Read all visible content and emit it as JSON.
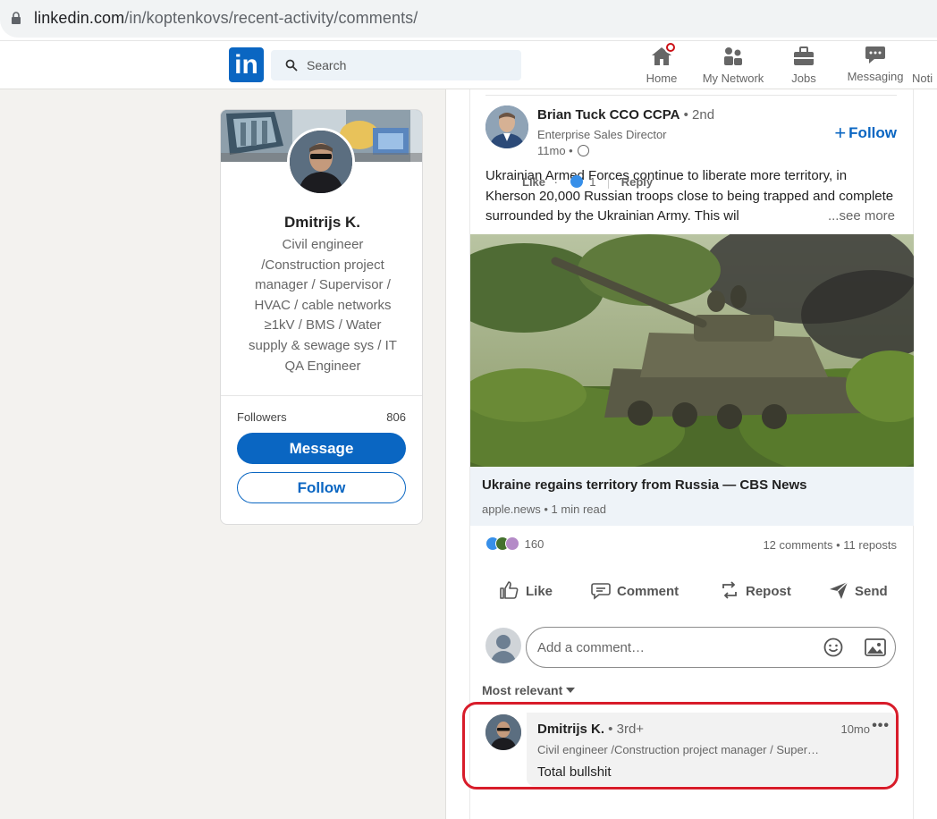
{
  "browser": {
    "url_host": "linkedin.com",
    "url_path": "/in/koptenkovs/recent-activity/comments/"
  },
  "nav": {
    "logo": "in",
    "search_placeholder": "Search",
    "items": [
      {
        "label": "Home",
        "icon": "home-icon"
      },
      {
        "label": "My Network",
        "icon": "network-icon"
      },
      {
        "label": "Jobs",
        "icon": "briefcase-icon"
      },
      {
        "label": "Messaging",
        "icon": "chat-icon"
      },
      {
        "label": "Noti",
        "icon": "bell-icon"
      }
    ]
  },
  "profile": {
    "name": "Dmitrijs K.",
    "headline": "Civil engineer /Construction project manager / Supervisor / HVAC / cable networks ≥1kV / BMS / Water supply & sewage sys / IT QA Engineer",
    "followers_label": "Followers",
    "followers_count": "806",
    "message_label": "Message",
    "follow_label": "Follow"
  },
  "post": {
    "author_name": "Brian Tuck CCO CCPA",
    "author_degree": " • 2nd",
    "author_title": "Enterprise Sales Director",
    "time": "11mo • ",
    "follow_label": "Follow",
    "text": "Ukrainian Armed Forces continue to liberate more territory, in Kherson 20,000 Russian troops close to being trapped and complete surrounded by the Ukrainian Army. This wil",
    "see_more": "...see more",
    "link_title": "Ukraine regains territory from Russia — CBS News",
    "link_source": "apple.news • 1 min read",
    "reaction_count": "160",
    "stats": "12 comments • 11 reposts",
    "actions": {
      "like": "Like",
      "comment": "Comment",
      "repost": "Repost",
      "send": "Send"
    },
    "comment_placeholder": "Add a comment…",
    "sort_label": "Most relevant"
  },
  "comment": {
    "name": "Dmitrijs K.",
    "degree": " • 3rd+",
    "time": "10mo",
    "more": "•••",
    "headline": "Civil engineer /Construction project manager / Super…",
    "text": "Total bullshit",
    "like_label": "Like",
    "dot": "·",
    "like_count": "1",
    "reply_label": "Reply"
  },
  "colors": {
    "brand": "#0a66c2",
    "highlight": "#d81c2a",
    "notification": "#cc1016"
  }
}
